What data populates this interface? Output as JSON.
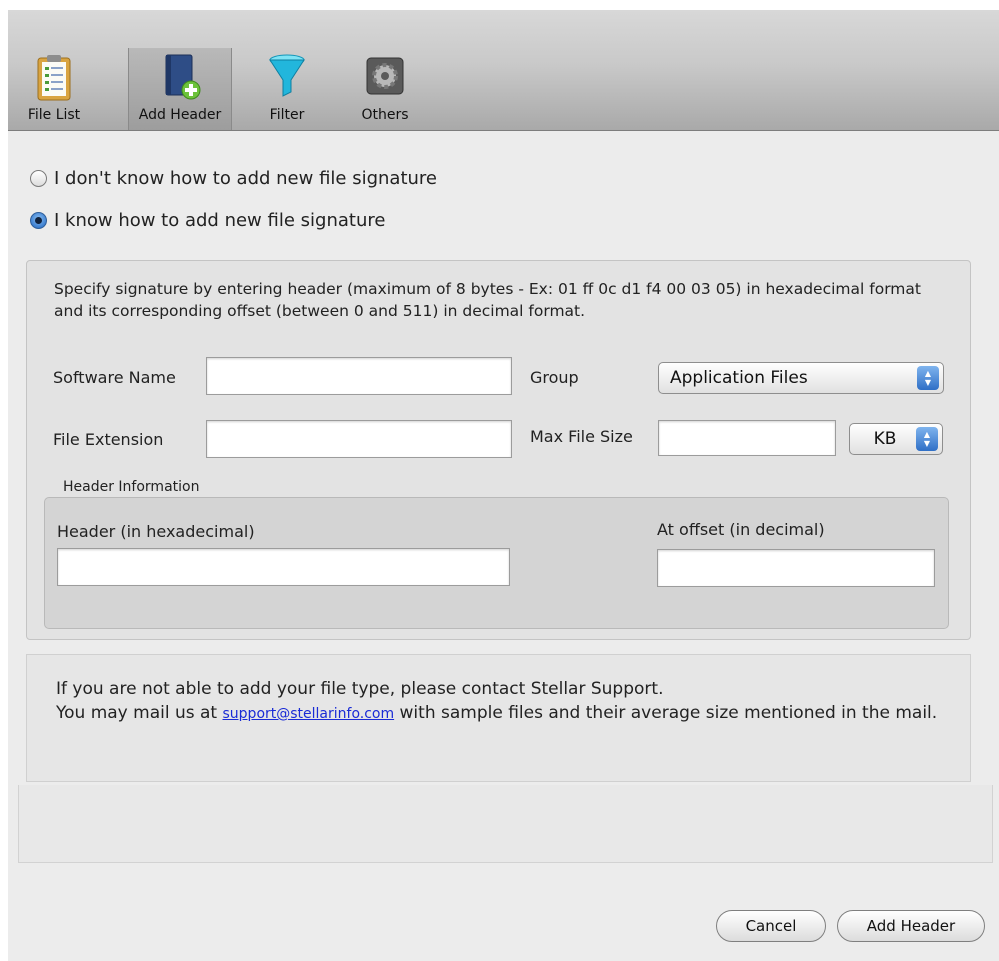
{
  "toolbar": {
    "items": [
      {
        "label": "File List",
        "icon": "clipboard-icon"
      },
      {
        "label": "Add Header",
        "icon": "book-add-icon"
      },
      {
        "label": "Filter",
        "icon": "filter-icon"
      },
      {
        "label": "Others",
        "icon": "gear-icon"
      }
    ],
    "selected": "Add Header"
  },
  "options": {
    "dont_know_label": "I don't know how to add new file signature",
    "know_label": "I know how to add new file signature",
    "selected": "know"
  },
  "form": {
    "description": "Specify signature by entering header (maximum of 8 bytes - Ex: 01 ff 0c d1 f4 00 03 05) in hexadecimal format and its corresponding offset (between 0 and 511) in decimal format.",
    "software_name_label": "Software Name",
    "software_name_value": "",
    "group_label": "Group",
    "group_value": "Application Files",
    "file_extension_label": "File Extension",
    "file_extension_value": "",
    "max_file_size_label": "Max File Size",
    "max_file_size_value": "",
    "size_unit_value": "KB",
    "header_info_caption": "Header Information",
    "header_hex_label": "Header (in hexadecimal)",
    "header_hex_value": "",
    "offset_label": "At offset (in decimal)",
    "offset_value": ""
  },
  "info": {
    "line1": "If you are not able to add your file type, please contact Stellar Support.",
    "line2_prefix": "You may mail us at",
    "email": "support@stellarinfo.com",
    "line2_suffix": "with sample files and their average size mentioned in the mail."
  },
  "buttons": {
    "cancel": "Cancel",
    "add_header": "Add Header"
  },
  "colors": {
    "accent": "#3d7fd0",
    "link": "#1a2bd6"
  }
}
